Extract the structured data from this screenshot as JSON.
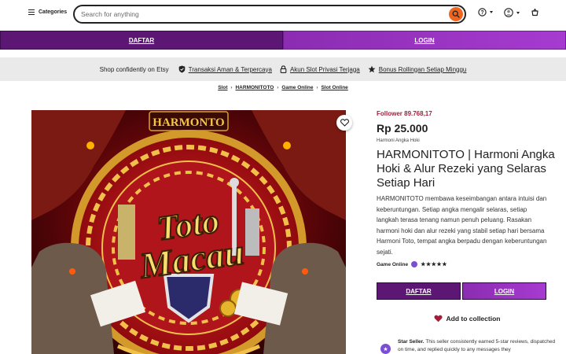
{
  "header": {
    "categories_label": "Categories",
    "search_placeholder": "Search for anything"
  },
  "top_actions": {
    "daftar_label": "DAFTAR",
    "login_label": "LOGIN"
  },
  "trust_bar": {
    "lead": "Shop confidently on Etsy",
    "items": [
      {
        "label": "Transaksi Aman & Terpercaya",
        "icon": "shield-check-icon"
      },
      {
        "label": "Akun Slot Privasi Terjaga",
        "icon": "lock-icon"
      },
      {
        "label": "Bonus Rollingan Setiap Minggu",
        "icon": "star-icon"
      }
    ]
  },
  "breadcrumb": [
    "Slot",
    "HARMONITOTO",
    "Game Online",
    "Slot Online"
  ],
  "image": {
    "logo_text": "HARMONTO",
    "art_text_line1": "Toto",
    "art_text_line2": "Macau"
  },
  "product": {
    "follower": "Follower 89.768,17",
    "price": "Rp 25.000",
    "shop_name": "Harmoni Angka Hoki",
    "title": "HARMONITOTO | Harmoni Angka Hoki & Alur Rezeki yang Selaras Setiap Hari",
    "description": "HARMONITOTO membawa keseimbangan antara intuisi dan keberuntungan. Setiap angka mengalir selaras, setiap langkah terasa tenang namun penuh peluang. Rasakan harmoni hoki dan alur rezeki yang stabil setiap hari bersama Harmoni Toto, tempat angka berpadu dengan keberuntungan sejati.",
    "category_label": "Game Online",
    "stars": "★★★★★",
    "rating": 5
  },
  "buy_actions": {
    "daftar_label": "DAFTAR",
    "login_label": "LOGIN"
  },
  "collection_label": "Add to collection",
  "seller": {
    "title": "Star Seller.",
    "text": "This seller consistently earned 5-star reviews, dispatched on time, and replied quickly to any messages they"
  },
  "colors": {
    "purple_dark": "#5c1674",
    "purple_light": "#a63bd0",
    "search_orange": "#f1641e",
    "follower_red": "#a61d3a"
  }
}
